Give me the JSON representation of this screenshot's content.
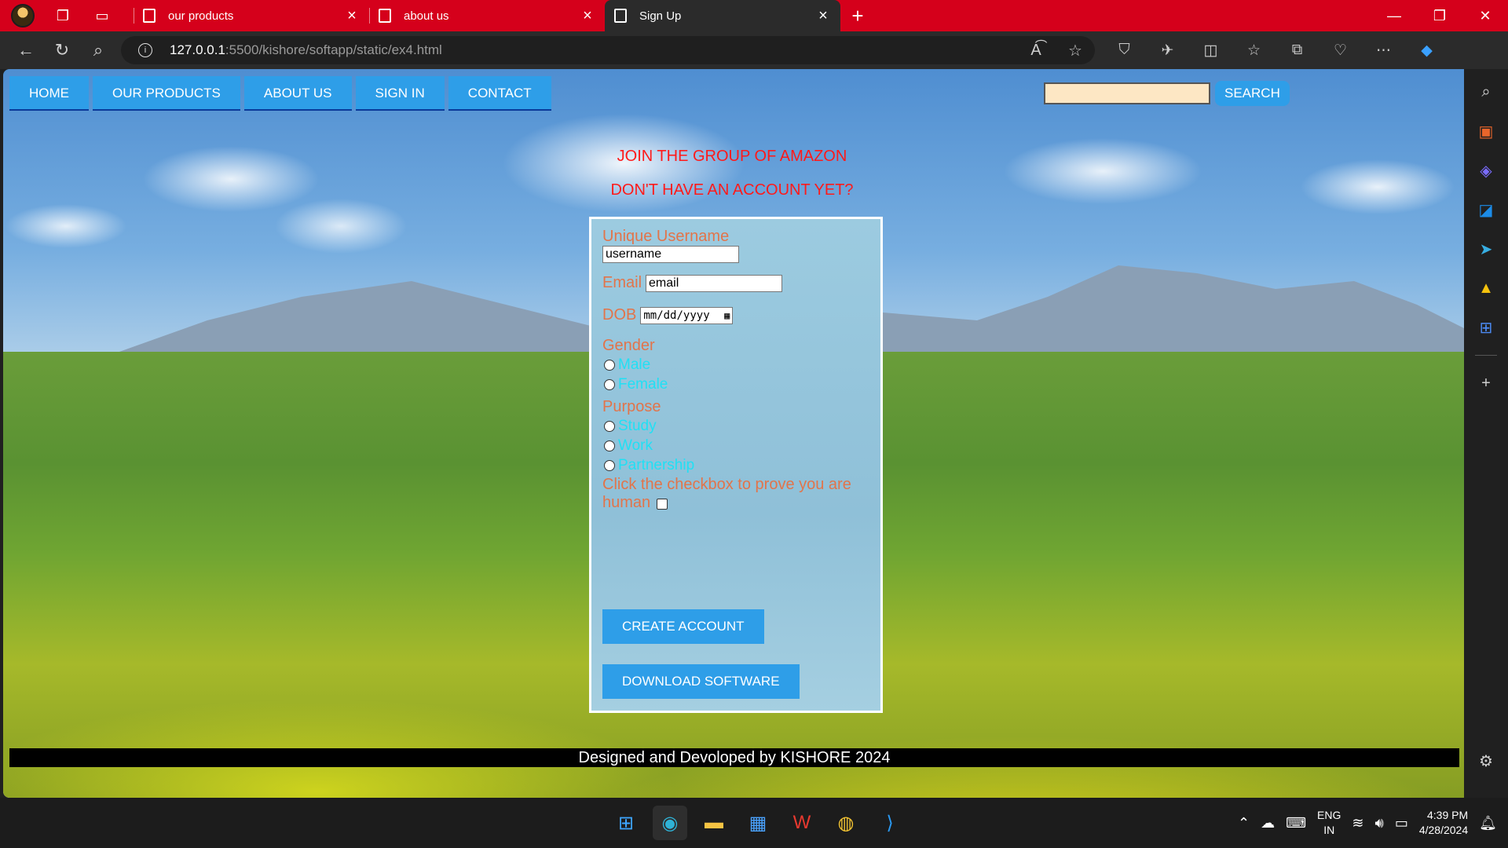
{
  "browser": {
    "tabs": [
      {
        "label": "our products"
      },
      {
        "label": "about us"
      },
      {
        "label": "Sign Up"
      }
    ],
    "url_host": "127.0.0.1",
    "url_path": ":5500/kishore/softapp/static/ex4.html"
  },
  "nav": {
    "items": [
      "HOME",
      "OUR PRODUCTS",
      "ABOUT US",
      "SIGN IN",
      "CONTACT"
    ],
    "search_button": "SEARCH"
  },
  "headings": {
    "line1": "JOIN THE GROUP OF AMAZON",
    "line2": "DON'T HAVE AN ACCOUNT YET?"
  },
  "form": {
    "username_label": "Unique Username",
    "username_value": "username",
    "email_label": "Email",
    "email_value": "email",
    "dob_label": "DOB",
    "dob_placeholder": "mm/dd/yyyy",
    "gender_label": "Gender",
    "gender_options": [
      "Male",
      "Female"
    ],
    "purpose_label": "Purpose",
    "purpose_options": [
      "Study",
      "Work",
      "Partnership"
    ],
    "human_label": "Click the checkbox to prove you are human",
    "create_button": "CREATE ACCOUNT",
    "download_button": "DOWNLOAD SOFTWARE"
  },
  "footer": {
    "text": "Designed and Devoloped by KISHORE 2024"
  },
  "taskbar": {
    "lang_top": "ENG",
    "lang_bottom": "IN",
    "time": "4:39 PM",
    "date": "4/28/2024"
  },
  "colors": {
    "titlebar": "#d5001b",
    "nav_button": "#2e9ee8",
    "heading": "#ff1a1a",
    "form_label": "#e2744a",
    "radio_label": "#20e0f4"
  }
}
